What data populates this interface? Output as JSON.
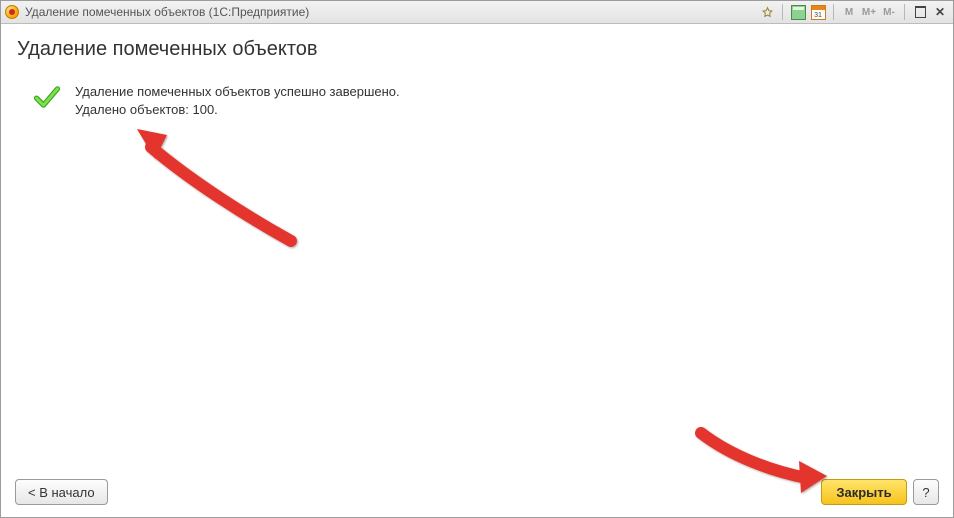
{
  "window": {
    "title": "Удаление помеченных объектов  (1С:Предприятие)"
  },
  "toolbar": {
    "mem_labels": [
      "M",
      "M+",
      "M-"
    ]
  },
  "page": {
    "title": "Удаление помеченных объектов",
    "success_line": "Удаление помеченных объектов успешно завершено.",
    "deleted_line": "Удалено объектов: 100."
  },
  "footer": {
    "back_label": "< В начало",
    "close_label": "Закрыть",
    "help_label": "?"
  }
}
